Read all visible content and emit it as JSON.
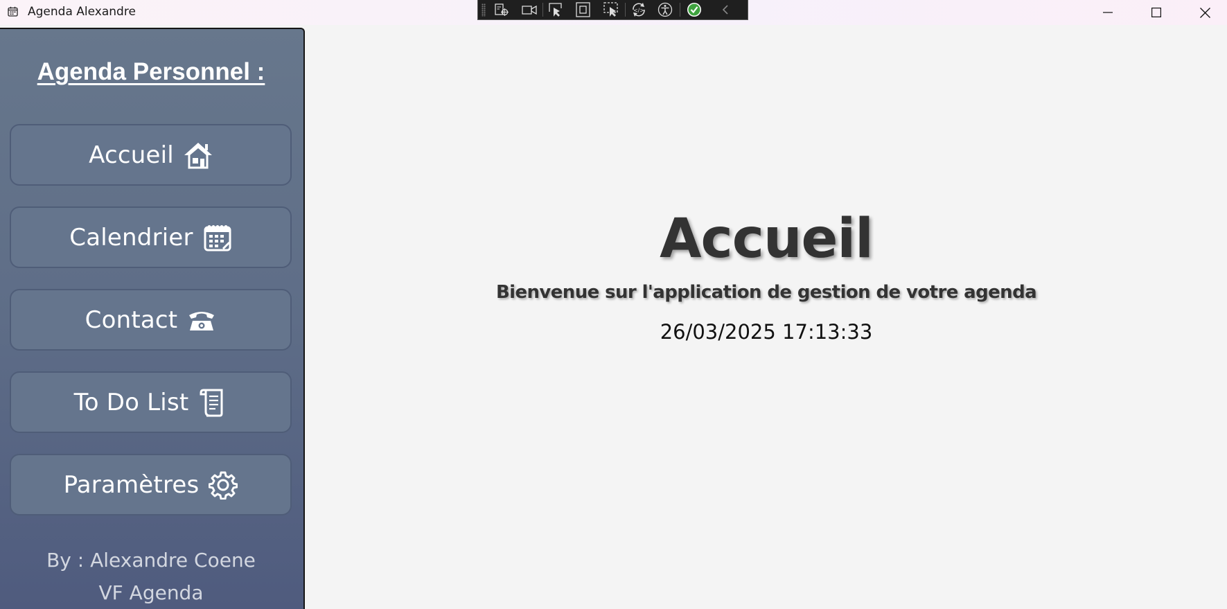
{
  "window": {
    "title": "Agenda Alexandre",
    "icon": "calendar-icon",
    "controls": [
      "minimize-icon",
      "maximize-icon",
      "close-icon"
    ]
  },
  "debug_toolbar": {
    "icons": [
      "live-visual-tree-icon",
      "record-icon",
      "select-element-icon",
      "display-layout-adorners-icon",
      "track-focus-icon",
      "hot-reload-icon",
      "accessibility-icon",
      "binding-failures-ok-icon",
      "collapse-icon"
    ]
  },
  "sidebar": {
    "title": "Agenda Personnel :",
    "items": [
      {
        "label": "Accueil",
        "icon": "home-icon"
      },
      {
        "label": "Calendrier",
        "icon": "calendar-icon"
      },
      {
        "label": "Contact",
        "icon": "telephone-icon"
      },
      {
        "label": "To Do List",
        "icon": "scroll-icon"
      },
      {
        "label": "Paramètres",
        "icon": "gear-icon"
      }
    ],
    "credit_author": "By : Alexandre Coene",
    "credit_version": "VF Agenda"
  },
  "main": {
    "title": "Accueil",
    "subtitle": "Bienvenue sur l'application de gestion de votre agenda",
    "datetime": "26/03/2025 17:13:33"
  },
  "colors": {
    "sidebar_top": "#67778c",
    "sidebar_bottom": "#4f5b7e",
    "button_bg": "#65758d",
    "content_bg": "#f4f4f4",
    "title_text": "#333333"
  }
}
